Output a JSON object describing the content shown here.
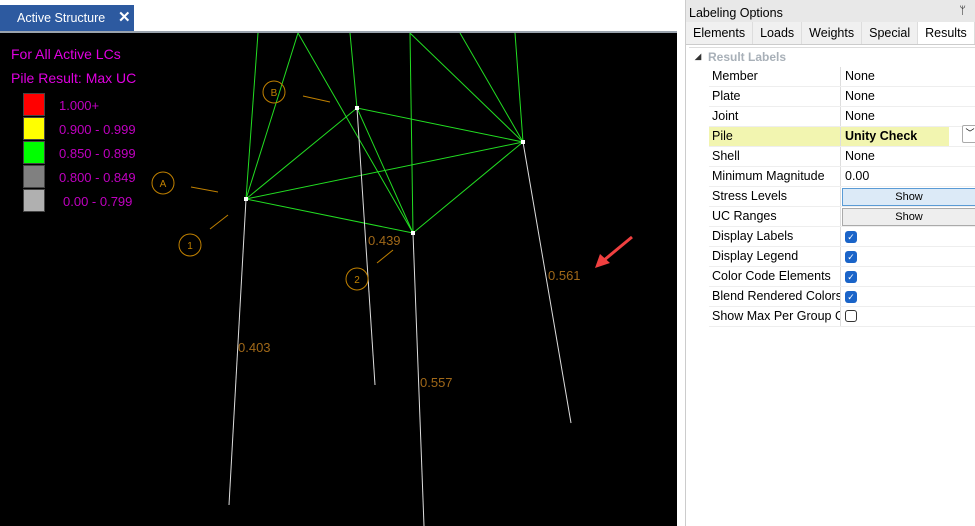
{
  "tab": {
    "title": "Active Structure",
    "close": "✕"
  },
  "legend": {
    "line1": "For All Active LCs",
    "line2": "Pile Result: Max UC",
    "ranges": [
      {
        "label": "1.000+",
        "color": "#ff0000"
      },
      {
        "label": "0.900 - 0.999",
        "color": "#ffff00"
      },
      {
        "label": "0.850 - 0.899",
        "color": "#00ff00"
      },
      {
        "label": "0.800 - 0.849",
        "color": "#808080"
      },
      {
        "label": "0.00 - 0.799",
        "color": "#b0b0b0"
      }
    ]
  },
  "model": {
    "markers": [
      "A",
      "B",
      "1",
      "2"
    ],
    "values": [
      "0.439",
      "0.403",
      "0.557",
      "0.561"
    ]
  },
  "panel": {
    "title": "Labeling Options",
    "pin": "ᛘ",
    "tabs": [
      "Elements",
      "Loads",
      "Weights",
      "Special",
      "Results"
    ],
    "active_tab": "Results",
    "section": "Result Labels",
    "rows": [
      {
        "k": "Member",
        "v": "None"
      },
      {
        "k": "Plate",
        "v": "None"
      },
      {
        "k": "Joint",
        "v": "None"
      },
      {
        "k": "Pile",
        "v": "Unity Check"
      },
      {
        "k": "Shell",
        "v": "None"
      },
      {
        "k": "Minimum Magnitude",
        "v": "0.00"
      },
      {
        "k": "Stress Levels",
        "v": "Show"
      },
      {
        "k": "UC Ranges",
        "v": "Show"
      },
      {
        "k": "Display Labels",
        "v": true
      },
      {
        "k": "Display Legend",
        "v": true
      },
      {
        "k": "Color Code Elements",
        "v": true
      },
      {
        "k": "Blend Rendered Colors",
        "v": true
      },
      {
        "k": "Show Max Per Group Or",
        "v": false
      }
    ]
  }
}
